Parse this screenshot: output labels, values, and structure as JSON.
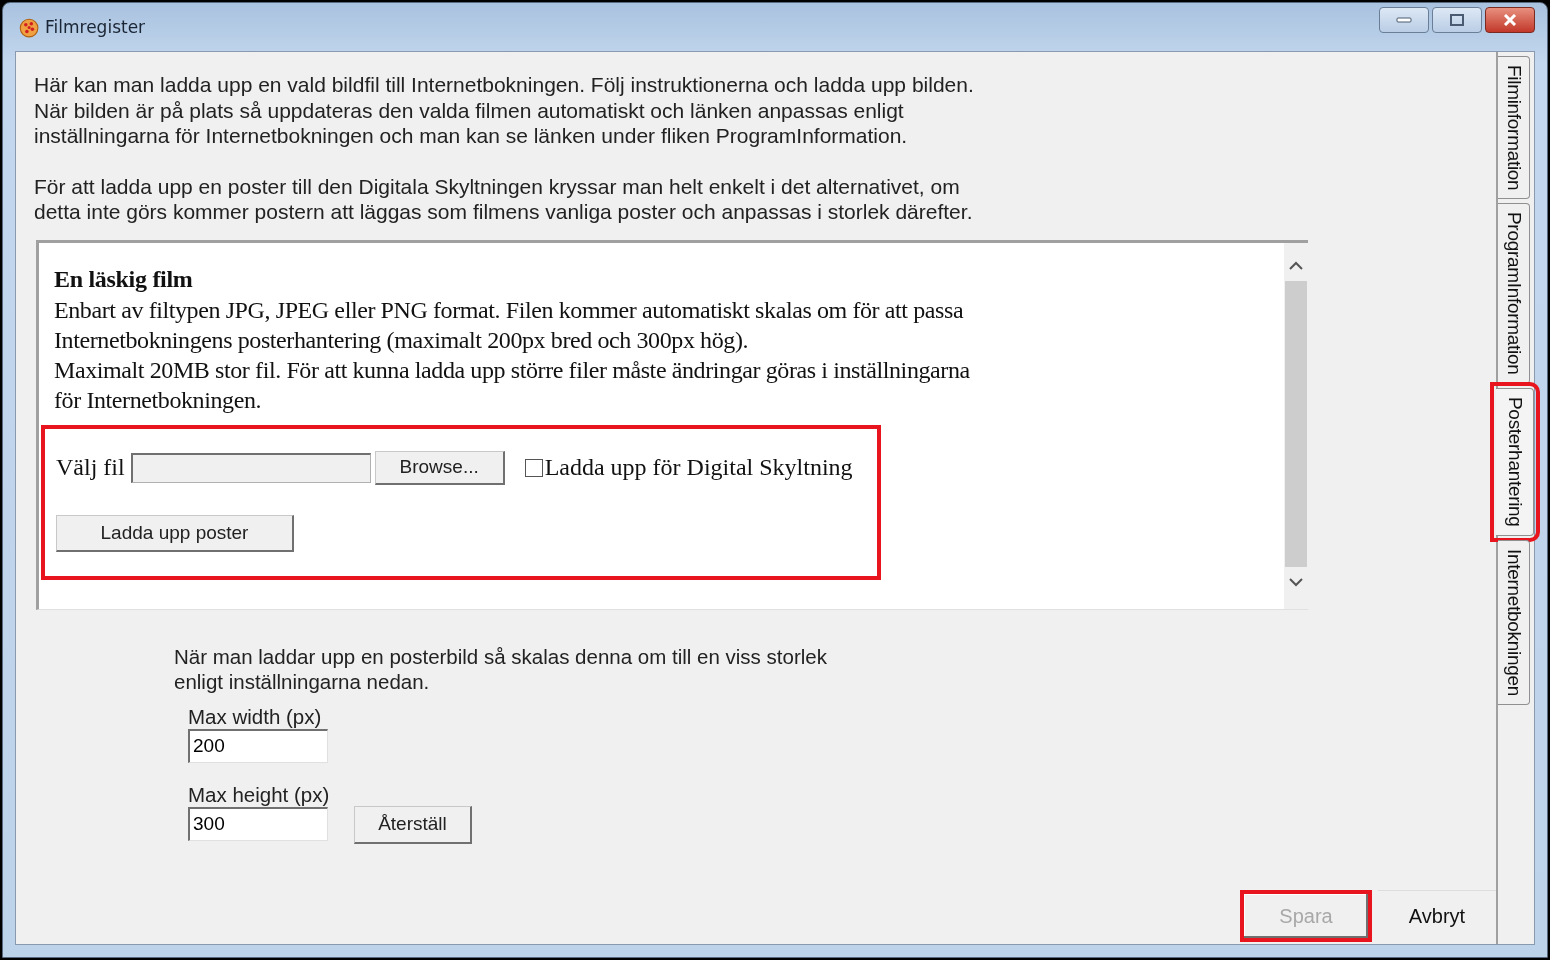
{
  "window": {
    "title": "Filmregister"
  },
  "intro": [
    "Här kan man ladda upp en vald bildfil till Internetbokningen. Följ instruktionerna och ladda upp bilden.",
    "När bilden är på plats så uppdateras den valda filmen automatiskt och länken anpassas enligt",
    "inställningarna för Internetbokningen och man kan se länken under fliken ProgramInformation."
  ],
  "intro2": [
    "För att ladda upp en poster till den Digitala Skyltningen kryssar man helt enkelt i det alternativet, om",
    "detta inte görs kommer postern att läggas som filmens vanliga poster och anpassas i storlek därefter."
  ],
  "browser": {
    "heading": "En läskig film",
    "lines": [
      "Enbart av filtypen JPG, JPEG eller PNG format. Filen kommer automatiskt skalas om för att passa",
      "Internetbokningens posterhantering (maximalt 200px bred och 300px hög).",
      "Maximalt 20MB stor fil. För att kunna ladda upp större filer måste ändringar göras i inställningarna",
      "för Internetbokningen."
    ],
    "upload": {
      "highlighted": true,
      "file_label": "Välj fil",
      "browse": "Browse...",
      "checkbox": {
        "label": "Ladda upp för Digital Skyltning",
        "checked": false
      },
      "button": "Ladda upp poster"
    }
  },
  "scale_note": [
    "När man laddar upp en posterbild så skalas denna om till en viss storlek",
    "enligt inställningarna nedan."
  ],
  "max_width": {
    "label": "Max width (px)",
    "value": "200"
  },
  "max_height": {
    "label": "Max height (px)",
    "value": "300"
  },
  "reset_button": "Återställ",
  "tabs": [
    {
      "label": "Filminformation",
      "selected": false,
      "highlighted": false
    },
    {
      "label": "ProgramInformation",
      "selected": false,
      "highlighted": false
    },
    {
      "label": "Posterhantering",
      "selected": true,
      "highlighted": true
    },
    {
      "label": "Internetbokningen",
      "selected": false,
      "highlighted": false
    }
  ],
  "buttons": [
    {
      "label": "Spara",
      "disabled": true,
      "highlighted": true
    },
    {
      "label": "Avbryt",
      "disabled": false,
      "highlighted": false
    }
  ]
}
